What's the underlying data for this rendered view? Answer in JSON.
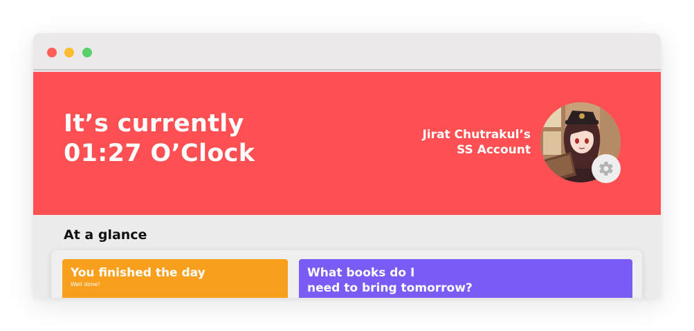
{
  "window": {
    "controls": [
      "close",
      "minimize",
      "maximize"
    ],
    "colors": {
      "close": "#fe5f57",
      "minimize": "#febc2e",
      "maximize": "#28c840"
    }
  },
  "hero": {
    "background": "#fe5052",
    "greeting_line1": "It’s currently",
    "greeting_line2": "01:27 O’Clock",
    "account_line1": "Jirat Chutrakul’s",
    "account_line2": "SS Account",
    "avatar_icon": "user-avatar-image",
    "settings_icon": "gear-icon"
  },
  "main": {
    "section_title": "At a glance",
    "cards": [
      {
        "title": "You finished the day",
        "subtitle": "Well done!",
        "color": "#f8a01e"
      },
      {
        "title_line1": "What books do I",
        "title_line2": "need to bring tomorrow?",
        "color": "#7a5cf5"
      }
    ]
  }
}
